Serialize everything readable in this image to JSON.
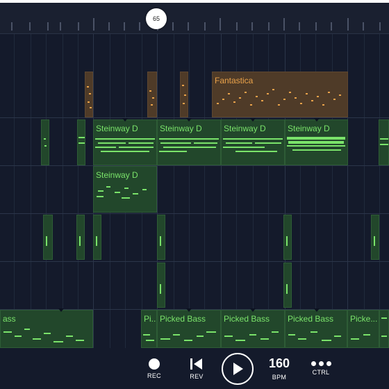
{
  "playhead": {
    "bar": "65"
  },
  "tracks": {
    "fantastica": {
      "clip_name": "Fantastica",
      "color": "#e9a24a"
    },
    "piano": {
      "clip_names": [
        "Steinway D",
        "Steinway D",
        "Steinway D",
        "Steinway D"
      ]
    },
    "piano2": {
      "clip_name": "Steinway D"
    },
    "bass": {
      "clip_names": [
        "ass",
        "Pi...",
        "Picked Bass",
        "Picked Bass",
        "Picked Bass",
        "Picke..."
      ]
    }
  },
  "colors": {
    "green_clip": "#22472b",
    "green_note": "#7ae36a",
    "orange_clip": "#4f3b28",
    "background": "#141a2b"
  },
  "transport": {
    "rec_label": "REC",
    "rev_label": "REV",
    "bpm_value": "160",
    "bpm_label": "BPM",
    "ctrl_label": "CTRL",
    "icons": {
      "rec": "record-icon",
      "rev": "rewind-icon",
      "play": "play-icon",
      "ctrl": "more-icon"
    }
  }
}
